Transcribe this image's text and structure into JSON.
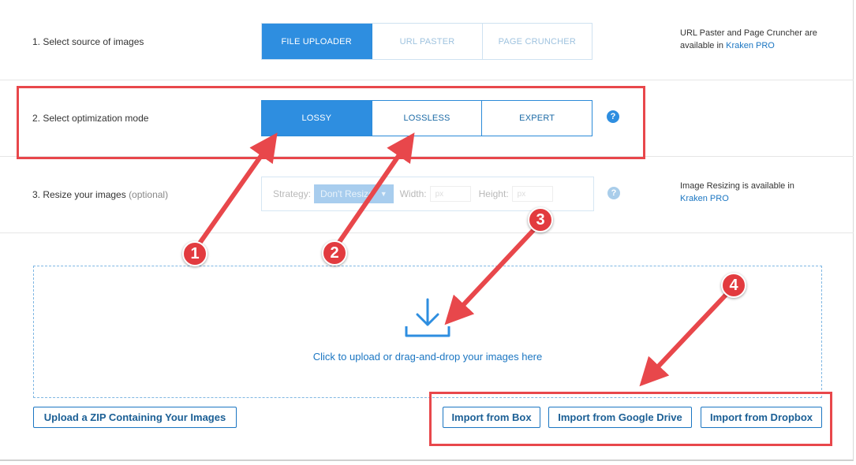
{
  "steps": {
    "source": {
      "label": "1. Select source of images",
      "options": [
        "FILE UPLOADER",
        "URL PASTER",
        "PAGE CRUNCHER"
      ],
      "selected": "FILE UPLOADER",
      "note_text": "URL Paster and Page Cruncher are available in",
      "note_link": "Kraken PRO"
    },
    "mode": {
      "label": "2. Select optimization mode",
      "options": [
        "LOSSY",
        "LOSSLESS",
        "EXPERT"
      ],
      "selected": "LOSSY",
      "help": "?"
    },
    "resize": {
      "label": "3. Resize your images",
      "optional": "(optional)",
      "strategy_label": "Strategy:",
      "strategy_value": "Don't Resize",
      "width_label": "Width:",
      "width_placeholder": "px",
      "height_label": "Height:",
      "height_placeholder": "px",
      "help": "?",
      "note_text": "Image Resizing is available in",
      "note_link": "Kraken PRO"
    }
  },
  "dropzone": {
    "text": "Click to upload or drag-and-drop your images here",
    "icon": "download-icon"
  },
  "buttons": {
    "zip": "Upload a ZIP Containing Your Images",
    "box": "Import from Box",
    "gdrive": "Import from Google Drive",
    "dropbox": "Import from Dropbox"
  },
  "annotations": [
    "1",
    "2",
    "3",
    "4"
  ],
  "colors": {
    "accent": "#2e8ee0",
    "link": "#1b76c2",
    "annotation": "#e8474b"
  }
}
